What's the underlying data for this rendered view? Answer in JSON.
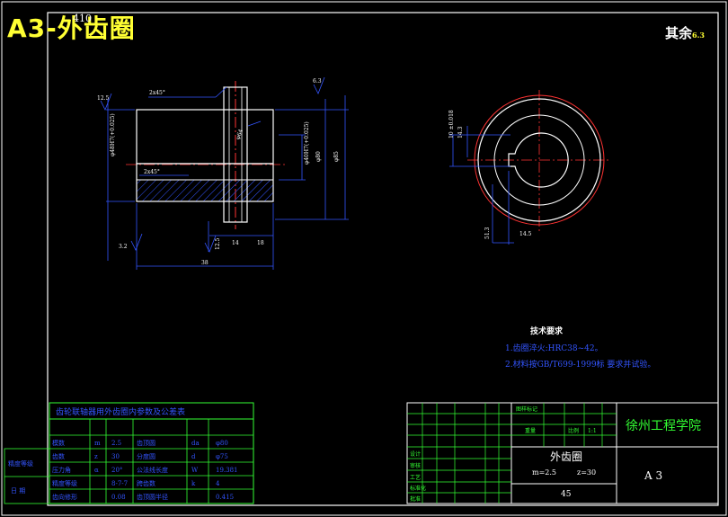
{
  "overlay": {
    "title": "A3-外齿圈",
    "sheet_code": "410"
  },
  "rest_label": "其余",
  "rest_roughness": "6.3",
  "front_view": {
    "chamfer_top": "2x45°",
    "chamfer_inner": "2x45°",
    "rough_left": "12.5",
    "rough_right": "6.3",
    "rough_bottom_left": "3.2",
    "rough_bottom_mid": "12.5",
    "dim_left_bore": "φ48H7(+0.025)",
    "dim_right_bore": "φ40H7(+0.025)",
    "dim_od_1": "φ80",
    "dim_od_2": "φ85",
    "dim_center": "φ64",
    "dim_bottom_1": "14",
    "dim_bottom_2": "18",
    "dim_total_width": "38"
  },
  "side_view": {
    "dim_keyway_width": "14.5",
    "dim_keyway_depth": "51.3",
    "dim_left_1": "10 ±0.018",
    "dim_left_2": "14.3"
  },
  "tech_requirements": {
    "title": "技术要求",
    "items": [
      "1.齿圈淬火:HRC38~42。",
      "2.材料按GB/T699-1999标  要求并试验。"
    ]
  },
  "param_table": {
    "title": "齿轮联轴器用外齿圈内参数及公差表",
    "rows": [
      [
        "模数",
        "m",
        "2.5",
        "齿顶圆",
        "da",
        "φ80"
      ],
      [
        "齿数",
        "z",
        "30",
        "分度圆",
        "d",
        "φ75"
      ],
      [
        "压力角",
        "α",
        "20°",
        "公法线长度",
        "W",
        "19.381"
      ],
      [
        "精度等级",
        "",
        "8-7-7",
        "跨齿数",
        "k",
        "4"
      ],
      [
        "齿向修形",
        "",
        "0.08",
        "齿顶圆半径",
        "",
        "0.415"
      ]
    ],
    "side_labels": [
      "精度等级",
      "日 期"
    ]
  },
  "title_block": {
    "school": "徐州工程学院",
    "part_name": "外齿圈",
    "module_label": "m=2.5",
    "teeth_label": "z=30",
    "material": "45",
    "paper_size": "A 3",
    "header_cells": [
      "图样标记",
      "重量",
      "比例",
      "1:1"
    ],
    "left_labels": [
      "设计",
      "审核",
      "工艺",
      "标准化",
      "批准"
    ]
  },
  "colors": {
    "background": "#000000",
    "frame": "#ffffff",
    "geometry": "#ffffff",
    "dimension": "#3355ff",
    "centerline": "#ff3333",
    "table_green": "#33ff33",
    "hatch": "#3355ff",
    "title_yellow": "#ffff33"
  }
}
